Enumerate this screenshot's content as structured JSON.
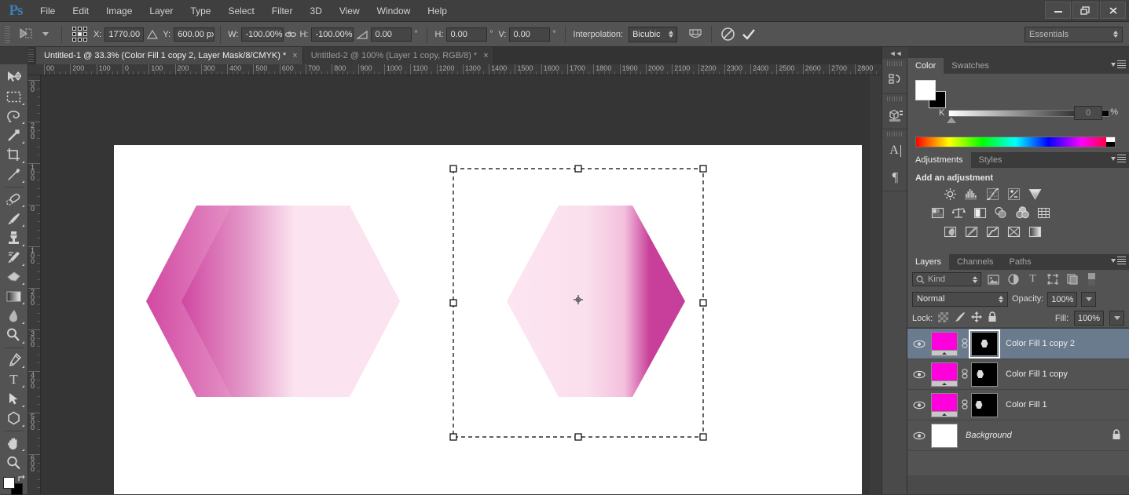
{
  "app": {
    "logo": "Ps",
    "workspace": "Essentials"
  },
  "menu": {
    "items": [
      "File",
      "Edit",
      "Image",
      "Layer",
      "Type",
      "Select",
      "Filter",
      "3D",
      "View",
      "Window",
      "Help"
    ]
  },
  "window_controls": {
    "minimize": "—",
    "restore": "❐",
    "close": "✕"
  },
  "options_bar": {
    "tool": "free-transform",
    "x_label": "X:",
    "x_value": "1770.00 px",
    "y_label": "Y:",
    "y_value": "600.00 px",
    "w_label": "W:",
    "w_value": "-100.00%",
    "h_label": "H:",
    "h_value": "-100.00%",
    "angle_value": "0.00",
    "angle_unit": "°",
    "skew_h_label": "H:",
    "skew_h_value": "0.00",
    "skew_h_unit": "°",
    "skew_v_label": "V:",
    "skew_v_value": "0.00",
    "skew_v_unit": "°",
    "interpolation_label": "Interpolation:",
    "interpolation_value": "Bicubic",
    "warp_toggle": "warp-mode",
    "cancel": "⊘",
    "commit": "✓"
  },
  "tabs": [
    {
      "title": "Untitled-1 @ 33.3% (Color Fill 1 copy 2, Layer Mask/8/CMYK) *",
      "close": "×",
      "active": true
    },
    {
      "title": "Untitled-2 @ 100% (Layer 1 copy, RGB/8) *",
      "close": "×",
      "active": false
    }
  ],
  "toolbar": {
    "tools": [
      {
        "name": "move-tool",
        "glyph": "move"
      },
      {
        "name": "marquee-tool",
        "glyph": "marquee"
      },
      {
        "name": "lasso-tool",
        "glyph": "lasso"
      },
      {
        "name": "magic-wand-tool",
        "glyph": "wand"
      },
      {
        "name": "crop-tool",
        "glyph": "crop"
      },
      {
        "name": "eyedropper-tool",
        "glyph": "eyedropper"
      },
      {
        "name": "healing-brush-tool",
        "glyph": "heal"
      },
      {
        "name": "brush-tool",
        "glyph": "brush"
      },
      {
        "name": "clone-stamp-tool",
        "glyph": "stamp"
      },
      {
        "name": "history-brush-tool",
        "glyph": "historybrush"
      },
      {
        "name": "eraser-tool",
        "glyph": "eraser"
      },
      {
        "name": "gradient-tool",
        "glyph": "gradient"
      },
      {
        "name": "blur-tool",
        "glyph": "blur"
      },
      {
        "name": "dodge-tool",
        "glyph": "dodge"
      },
      {
        "name": "pen-tool",
        "glyph": "pen"
      },
      {
        "name": "type-tool",
        "glyph": "T"
      },
      {
        "name": "path-selection-tool",
        "glyph": "arrow"
      },
      {
        "name": "shape-tool",
        "glyph": "polygon"
      },
      {
        "name": "hand-tool",
        "glyph": "hand"
      },
      {
        "name": "zoom-tool",
        "glyph": "zoom"
      }
    ],
    "foreground_color": "#ffffff",
    "background_color": "#000000"
  },
  "rulers": {
    "horizontal": [
      "00",
      "200",
      "100",
      "0",
      "100",
      "200",
      "300",
      "400",
      "500",
      "600",
      "700",
      "800",
      "900",
      "1000",
      "1100",
      "1200",
      "1300",
      "1400",
      "1500",
      "1600",
      "1700",
      "1800",
      "1900",
      "2000",
      "2100",
      "2200",
      "2300",
      "2400",
      "2500",
      "2600",
      "2700",
      "2800"
    ],
    "vertical": [
      "00",
      "200",
      "100",
      "0",
      "100",
      "200",
      "300",
      "400",
      "500",
      "600"
    ]
  },
  "canvas": {
    "zoom": "33.3%",
    "background": "#ffffff",
    "shapes": [
      {
        "name": "hexagon-back",
        "fill_from": "#fbe2ee",
        "fill_to": "#fbe2ee"
      },
      {
        "name": "hexagon-middle",
        "fill_from": "#d149a2",
        "fill_to": "#fbe2ee"
      },
      {
        "name": "hexagon-front",
        "fill_from": "#d149a2",
        "fill_to": "#fbe2ee"
      },
      {
        "name": "hexagon-transformed",
        "fill_from": "#fbe2ee",
        "fill_to": "#c43f9b"
      }
    ],
    "transform_box": {
      "visible": true,
      "handles": 8,
      "center_point": true
    }
  },
  "dock": {
    "collapse": "◄◄",
    "buttons": [
      {
        "name": "history-panel-icon",
        "glyph": "history"
      },
      {
        "name": "3d-panel-icon",
        "glyph": "3d"
      },
      {
        "name": "character-panel-icon",
        "glyph": "A"
      },
      {
        "name": "paragraph-panel-icon",
        "glyph": "¶"
      }
    ]
  },
  "color_panel": {
    "tabs": [
      "Color",
      "Swatches"
    ],
    "active_tab": "Color",
    "channel_label": "K",
    "channel_value": "0",
    "percent": "%",
    "foreground": "#ffffff",
    "background": "#000000"
  },
  "adjustments_panel": {
    "tabs": [
      "Adjustments",
      "Styles"
    ],
    "active_tab": "Adjustments",
    "title": "Add an adjustment",
    "row1": [
      "brightness-contrast-icon",
      "levels-icon",
      "curves-icon",
      "exposure-icon",
      "vibrance-icon"
    ],
    "row2": [
      "hue-saturation-icon",
      "color-balance-icon",
      "black-white-icon",
      "photo-filter-icon",
      "channel-mixer-icon",
      "color-lookup-icon"
    ],
    "row3": [
      "invert-icon",
      "posterize-icon",
      "threshold-icon",
      "selective-color-icon",
      "gradient-map-icon"
    ]
  },
  "layers_panel": {
    "tabs": [
      "Layers",
      "Channels",
      "Paths"
    ],
    "active_tab": "Layers",
    "filter_kind": "Kind",
    "filter_icons": [
      "pixel-filter-icon",
      "adjustment-filter-icon",
      "type-filter-icon",
      "shape-filter-icon",
      "smart-object-filter-icon"
    ],
    "blend_mode": "Normal",
    "opacity_label": "Opacity:",
    "opacity_value": "100%",
    "lock_label": "Lock:",
    "lock_icons": [
      "lock-transparent-icon",
      "lock-image-icon",
      "lock-position-icon",
      "lock-all-icon"
    ],
    "fill_label": "Fill:",
    "fill_value": "100%",
    "layers": [
      {
        "name": "Color Fill 1 copy 2",
        "selected": true,
        "visible": true,
        "type": "fill",
        "mask": true,
        "mask_active": true,
        "locked": false,
        "italic": false,
        "fill_color": "#ff00dd"
      },
      {
        "name": "Color Fill 1 copy",
        "selected": false,
        "visible": true,
        "type": "fill",
        "mask": true,
        "mask_active": false,
        "locked": false,
        "italic": false,
        "fill_color": "#ff00dd"
      },
      {
        "name": "Color Fill 1",
        "selected": false,
        "visible": true,
        "type": "fill",
        "mask": true,
        "mask_active": false,
        "locked": false,
        "italic": false,
        "fill_color": "#ff00dd"
      },
      {
        "name": "Background",
        "selected": false,
        "visible": true,
        "type": "raster",
        "mask": false,
        "mask_active": false,
        "locked": true,
        "italic": true,
        "fill_color": "#ffffff"
      }
    ]
  }
}
